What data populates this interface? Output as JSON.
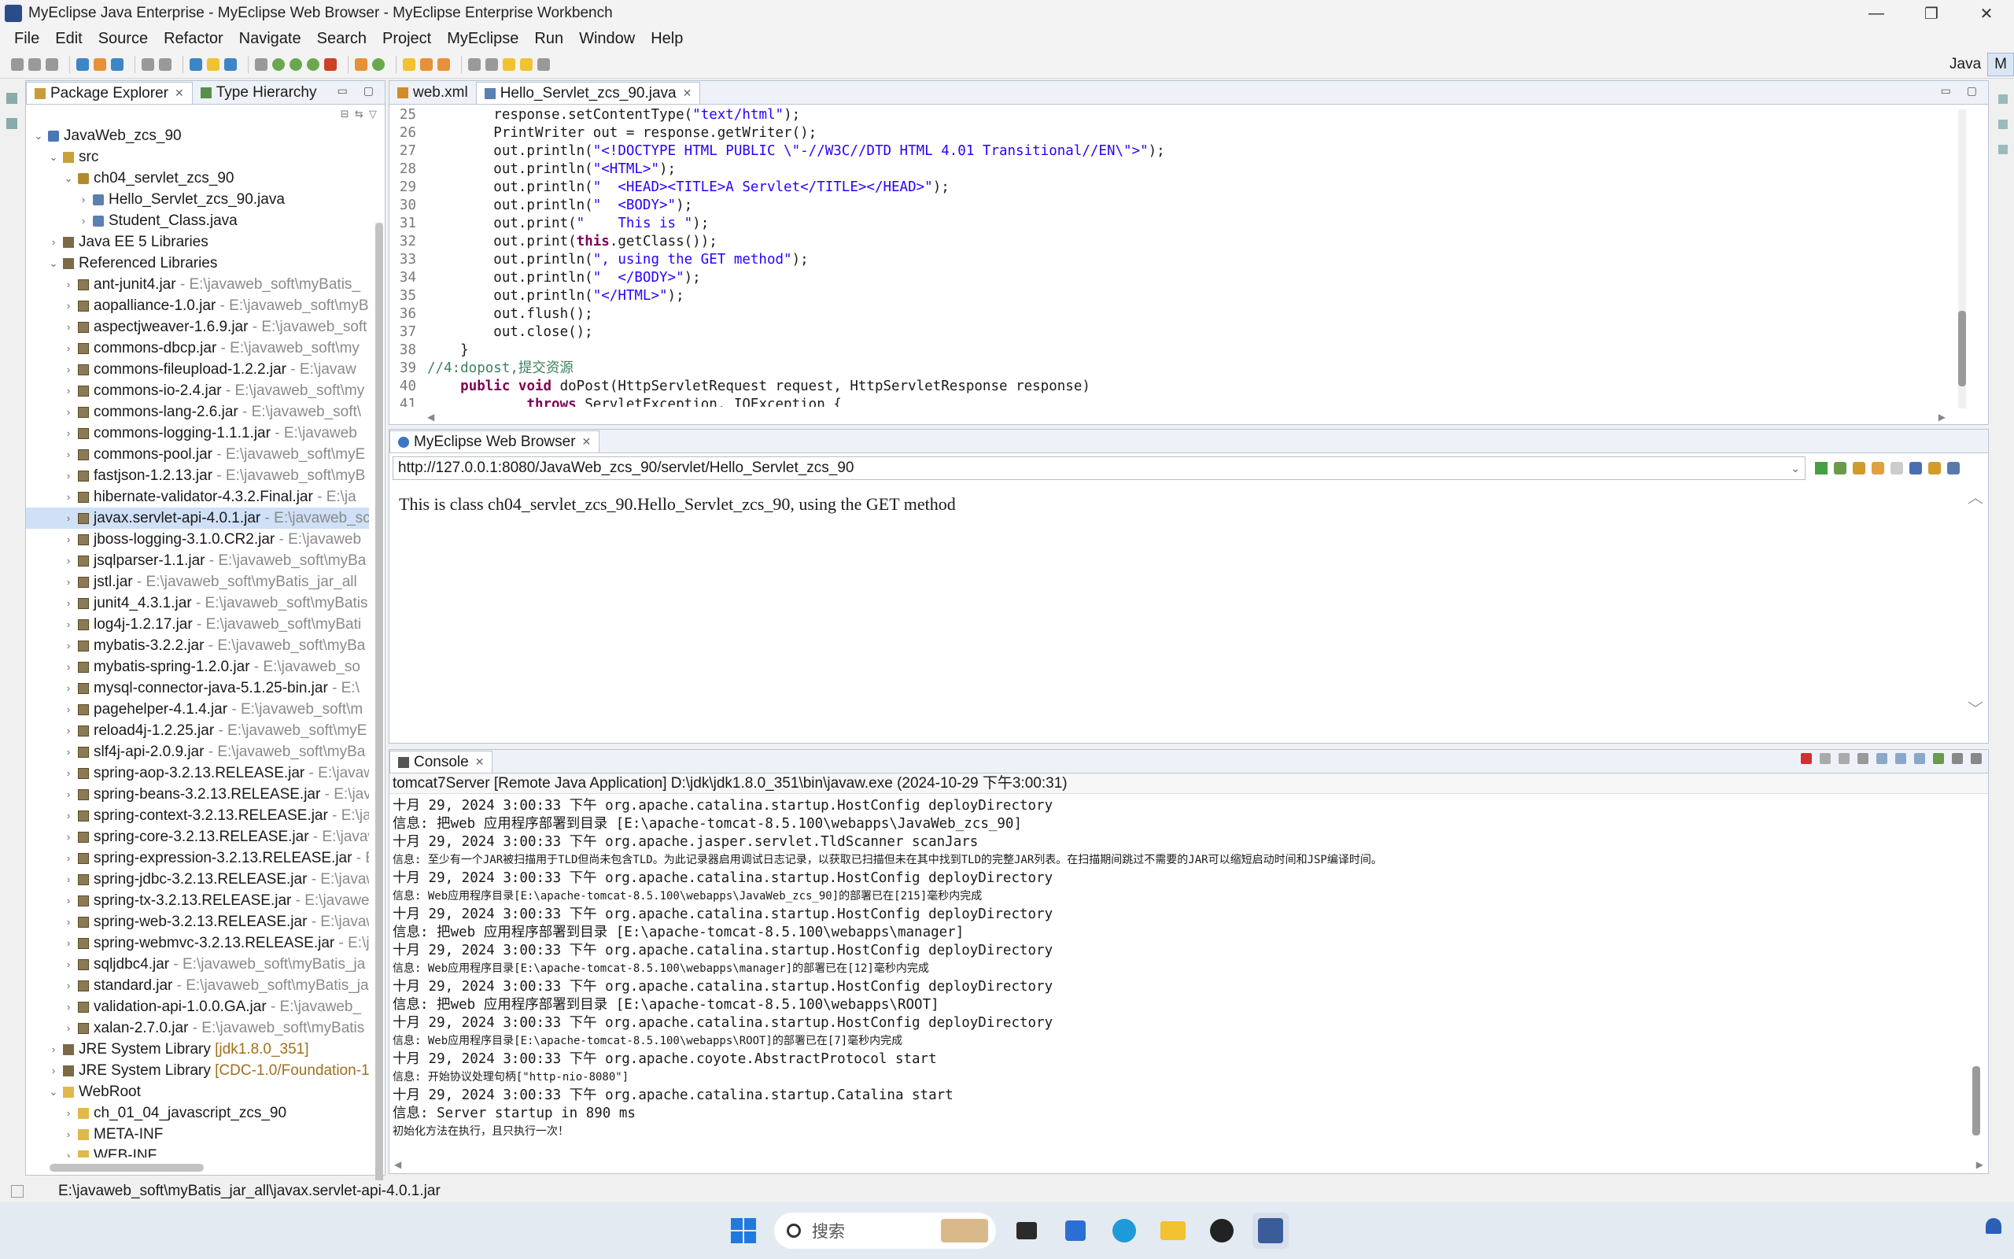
{
  "window": {
    "title": "MyEclipse Java Enterprise - MyEclipse Web Browser - MyEclipse Enterprise Workbench",
    "minimize": "—",
    "maximize": "❐",
    "close": "✕"
  },
  "menu": [
    "File",
    "Edit",
    "Source",
    "Refactor",
    "Navigate",
    "Search",
    "Project",
    "MyEclipse",
    "Run",
    "Window",
    "Help"
  ],
  "perspective": {
    "java": "Java",
    "myeclipse": "M"
  },
  "left_panel": {
    "tabs": [
      "Package Explorer",
      "Type Hierarchy"
    ],
    "tree": [
      {
        "label": "JavaWeb_zcs_90",
        "detail": "",
        "level": 0,
        "arrow": "v",
        "icon": "proj"
      },
      {
        "label": "src",
        "detail": "",
        "level": 1,
        "arrow": "v",
        "icon": "src"
      },
      {
        "label": "ch04_servlet_zcs_90",
        "detail": "",
        "level": 2,
        "arrow": "v",
        "icon": "pkgi"
      },
      {
        "label": "Hello_Servlet_zcs_90.java",
        "detail": "",
        "level": 3,
        "arrow": ">",
        "icon": "java"
      },
      {
        "label": "Student_Class.java",
        "detail": "",
        "level": 3,
        "arrow": ">",
        "icon": "java"
      },
      {
        "label": "Java EE 5 Libraries",
        "detail": "",
        "level": 1,
        "arrow": ">",
        "icon": "lib"
      },
      {
        "label": "Referenced Libraries",
        "detail": "",
        "level": 1,
        "arrow": "v",
        "icon": "lib"
      },
      {
        "label": "ant-junit4.jar",
        "detail": " - E:\\javaweb_soft\\myBatis_",
        "level": 2,
        "arrow": ">",
        "icon": "jar"
      },
      {
        "label": "aopalliance-1.0.jar",
        "detail": " - E:\\javaweb_soft\\myB",
        "level": 2,
        "arrow": ">",
        "icon": "jar"
      },
      {
        "label": "aspectjweaver-1.6.9.jar",
        "detail": " - E:\\javaweb_soft",
        "level": 2,
        "arrow": ">",
        "icon": "jar"
      },
      {
        "label": "commons-dbcp.jar",
        "detail": " - E:\\javaweb_soft\\my",
        "level": 2,
        "arrow": ">",
        "icon": "jar"
      },
      {
        "label": "commons-fileupload-1.2.2.jar",
        "detail": " - E:\\javaw",
        "level": 2,
        "arrow": ">",
        "icon": "jar"
      },
      {
        "label": "commons-io-2.4.jar",
        "detail": " - E:\\javaweb_soft\\my",
        "level": 2,
        "arrow": ">",
        "icon": "jar"
      },
      {
        "label": "commons-lang-2.6.jar",
        "detail": " - E:\\javaweb_soft\\",
        "level": 2,
        "arrow": ">",
        "icon": "jar"
      },
      {
        "label": "commons-logging-1.1.1.jar",
        "detail": " - E:\\javaweb",
        "level": 2,
        "arrow": ">",
        "icon": "jar"
      },
      {
        "label": "commons-pool.jar",
        "detail": " - E:\\javaweb_soft\\myE",
        "level": 2,
        "arrow": ">",
        "icon": "jar"
      },
      {
        "label": "fastjson-1.2.13.jar",
        "detail": " - E:\\javaweb_soft\\myB",
        "level": 2,
        "arrow": ">",
        "icon": "jar"
      },
      {
        "label": "hibernate-validator-4.3.2.Final.jar",
        "detail": " - E:\\ja",
        "level": 2,
        "arrow": ">",
        "icon": "jar"
      },
      {
        "label": "javax.servlet-api-4.0.1.jar",
        "detail": " - E:\\javaweb_sc",
        "level": 2,
        "arrow": ">",
        "icon": "jar",
        "selected": true
      },
      {
        "label": "jboss-logging-3.1.0.CR2.jar",
        "detail": " - E:\\javaweb",
        "level": 2,
        "arrow": ">",
        "icon": "jar"
      },
      {
        "label": "jsqlparser-1.1.jar",
        "detail": " - E:\\javaweb_soft\\myBa",
        "level": 2,
        "arrow": ">",
        "icon": "jar"
      },
      {
        "label": "jstl.jar",
        "detail": " - E:\\javaweb_soft\\myBatis_jar_all",
        "level": 2,
        "arrow": ">",
        "icon": "jar"
      },
      {
        "label": "junit4_4.3.1.jar",
        "detail": " - E:\\javaweb_soft\\myBatis",
        "level": 2,
        "arrow": ">",
        "icon": "jar"
      },
      {
        "label": "log4j-1.2.17.jar",
        "detail": " - E:\\javaweb_soft\\myBati",
        "level": 2,
        "arrow": ">",
        "icon": "jar"
      },
      {
        "label": "mybatis-3.2.2.jar",
        "detail": " - E:\\javaweb_soft\\myBa",
        "level": 2,
        "arrow": ">",
        "icon": "jar"
      },
      {
        "label": "mybatis-spring-1.2.0.jar",
        "detail": " - E:\\javaweb_so",
        "level": 2,
        "arrow": ">",
        "icon": "jar"
      },
      {
        "label": "mysql-connector-java-5.1.25-bin.jar",
        "detail": " - E:\\",
        "level": 2,
        "arrow": ">",
        "icon": "jar"
      },
      {
        "label": "pagehelper-4.1.4.jar",
        "detail": " - E:\\javaweb_soft\\m",
        "level": 2,
        "arrow": ">",
        "icon": "jar"
      },
      {
        "label": "reload4j-1.2.25.jar",
        "detail": " - E:\\javaweb_soft\\myE",
        "level": 2,
        "arrow": ">",
        "icon": "jar"
      },
      {
        "label": "slf4j-api-2.0.9.jar",
        "detail": " - E:\\javaweb_soft\\myBa",
        "level": 2,
        "arrow": ">",
        "icon": "jar"
      },
      {
        "label": "spring-aop-3.2.13.RELEASE.jar",
        "detail": " - E:\\javaw",
        "level": 2,
        "arrow": ">",
        "icon": "jar"
      },
      {
        "label": "spring-beans-3.2.13.RELEASE.jar",
        "detail": " - E:\\javc",
        "level": 2,
        "arrow": ">",
        "icon": "jar"
      },
      {
        "label": "spring-context-3.2.13.RELEASE.jar",
        "detail": " - E:\\ja",
        "level": 2,
        "arrow": ">",
        "icon": "jar"
      },
      {
        "label": "spring-core-3.2.13.RELEASE.jar",
        "detail": " - E:\\javaw",
        "level": 2,
        "arrow": ">",
        "icon": "jar"
      },
      {
        "label": "spring-expression-3.2.13.RELEASE.jar",
        "detail": " - E",
        "level": 2,
        "arrow": ">",
        "icon": "jar"
      },
      {
        "label": "spring-jdbc-3.2.13.RELEASE.jar",
        "detail": " - E:\\javaw",
        "level": 2,
        "arrow": ">",
        "icon": "jar"
      },
      {
        "label": "spring-tx-3.2.13.RELEASE.jar",
        "detail": " - E:\\javawel",
        "level": 2,
        "arrow": ">",
        "icon": "jar"
      },
      {
        "label": "spring-web-3.2.13.RELEASE.jar",
        "detail": " - E:\\javaw",
        "level": 2,
        "arrow": ">",
        "icon": "jar"
      },
      {
        "label": "spring-webmvc-3.2.13.RELEASE.jar",
        "detail": " - E:\\ja",
        "level": 2,
        "arrow": ">",
        "icon": "jar"
      },
      {
        "label": "sqljdbc4.jar",
        "detail": " - E:\\javaweb_soft\\myBatis_ja",
        "level": 2,
        "arrow": ">",
        "icon": "jar"
      },
      {
        "label": "standard.jar",
        "detail": " - E:\\javaweb_soft\\myBatis_ja",
        "level": 2,
        "arrow": ">",
        "icon": "jar"
      },
      {
        "label": "validation-api-1.0.0.GA.jar",
        "detail": " - E:\\javaweb_",
        "level": 2,
        "arrow": ">",
        "icon": "jar"
      },
      {
        "label": "xalan-2.7.0.jar",
        "detail": " - E:\\javaweb_soft\\myBatis",
        "level": 2,
        "arrow": ">",
        "icon": "jar"
      },
      {
        "label": "JRE System Library",
        "detail": " [jdk1.8.0_351]",
        "level": 1,
        "arrow": ">",
        "icon": "lib",
        "amber": true
      },
      {
        "label": "JRE System Library",
        "detail": " [CDC-1.0/Foundation-1",
        "level": 1,
        "arrow": ">",
        "icon": "lib",
        "amber": true
      },
      {
        "label": "WebRoot",
        "detail": "",
        "level": 1,
        "arrow": "v",
        "icon": "folder"
      },
      {
        "label": "ch_01_04_javascript_zcs_90",
        "detail": "",
        "level": 2,
        "arrow": ">",
        "icon": "folder"
      },
      {
        "label": "META-INF",
        "detail": "",
        "level": 2,
        "arrow": ">",
        "icon": "folder"
      },
      {
        "label": "WEB-INF",
        "detail": "",
        "level": 2,
        "arrow": ">",
        "icon": "folder"
      }
    ]
  },
  "editor": {
    "tabs": [
      "web.xml",
      "Hello_Servlet_zcs_90.java"
    ],
    "lines": [
      {
        "n": "25",
        "html": "        response.setContentType(<span class=\"str\">\"text/html\"</span>);"
      },
      {
        "n": "26",
        "html": "        PrintWriter out = response.getWriter();"
      },
      {
        "n": "27",
        "html": "        out.println(<span class=\"str\">\"&lt;!DOCTYPE HTML PUBLIC \\\"-//W3C//DTD HTML 4.01 Transitional//EN\\\"&gt;\"</span>);"
      },
      {
        "n": "28",
        "html": "        out.println(<span class=\"str\">\"&lt;HTML&gt;\"</span>);"
      },
      {
        "n": "29",
        "html": "        out.println(<span class=\"str\">\"  &lt;HEAD&gt;&lt;TITLE&gt;A Servlet&lt;/TITLE&gt;&lt;/HEAD&gt;\"</span>);"
      },
      {
        "n": "30",
        "html": "        out.println(<span class=\"str\">\"  &lt;BODY&gt;\"</span>);"
      },
      {
        "n": "31",
        "html": "        out.print(<span class=\"str\">\"    This is \"</span>);"
      },
      {
        "n": "32",
        "html": "        out.print(<span class=\"kw\">this</span>.getClass());"
      },
      {
        "n": "33",
        "html": "        out.println(<span class=\"str\">\", using the GET method\"</span>);"
      },
      {
        "n": "34",
        "html": "        out.println(<span class=\"str\">\"  &lt;/BODY&gt;\"</span>);"
      },
      {
        "n": "35",
        "html": "        out.println(<span class=\"str\">\"&lt;/HTML&gt;\"</span>);"
      },
      {
        "n": "36",
        "html": "        out.flush();"
      },
      {
        "n": "37",
        "html": "        out.close();"
      },
      {
        "n": "38",
        "html": "    }"
      },
      {
        "n": "39",
        "html": "<span class=\"cmt\">//4:dopost,提交资源</span>"
      },
      {
        "n": "40",
        "html": "    <span class=\"kw\">public void</span> doPost(HttpServletRequest request, HttpServletResponse response)"
      },
      {
        "n": "41",
        "html": "            <span class=\"kw\">throws</span> ServletException, IOException {"
      }
    ]
  },
  "browser": {
    "tab": "MyEclipse Web Browser",
    "url": "http://127.0.0.1:8080/JavaWeb_zcs_90/servlet/Hello_Servlet_zcs_90",
    "content": "This is class ch04_servlet_zcs_90.Hello_Servlet_zcs_90, using the GET method"
  },
  "console": {
    "tab": "Console",
    "title": "tomcat7Server [Remote Java Application] D:\\jdk\\jdk1.8.0_351\\bin\\javaw.exe (2024-10-29 下午3:00:31)",
    "lines": [
      {
        "t": "十月 29, 2024 3:00:33 下午 org.apache.catalina.startup.HostConfig deployDirectory",
        "small": false
      },
      {
        "t": "信息: 把web 应用程序部署到目录 [E:\\apache-tomcat-8.5.100\\webapps\\JavaWeb_zcs_90]",
        "small": false
      },
      {
        "t": "十月 29, 2024 3:00:33 下午 org.apache.jasper.servlet.TldScanner scanJars",
        "small": false
      },
      {
        "t": "信息: 至少有一个JAR被扫描用于TLD但尚未包含TLD。为此记录器启用调试日志记录，以获取已扫描但未在其中找到TLD的完整JAR列表。在扫描期间跳过不需要的JAR可以缩短启动时间和JSP编译时间。",
        "small": true
      },
      {
        "t": "十月 29, 2024 3:00:33 下午 org.apache.catalina.startup.HostConfig deployDirectory",
        "small": false
      },
      {
        "t": "信息: Web应用程序目录[E:\\apache-tomcat-8.5.100\\webapps\\JavaWeb_zcs_90]的部署已在[215]毫秒内完成",
        "small": true
      },
      {
        "t": "十月 29, 2024 3:00:33 下午 org.apache.catalina.startup.HostConfig deployDirectory",
        "small": false
      },
      {
        "t": "信息: 把web 应用程序部署到目录 [E:\\apache-tomcat-8.5.100\\webapps\\manager]",
        "small": false
      },
      {
        "t": "十月 29, 2024 3:00:33 下午 org.apache.catalina.startup.HostConfig deployDirectory",
        "small": false
      },
      {
        "t": "信息: Web应用程序目录[E:\\apache-tomcat-8.5.100\\webapps\\manager]的部署已在[12]毫秒内完成",
        "small": true
      },
      {
        "t": "十月 29, 2024 3:00:33 下午 org.apache.catalina.startup.HostConfig deployDirectory",
        "small": false
      },
      {
        "t": "信息: 把web 应用程序部署到目录 [E:\\apache-tomcat-8.5.100\\webapps\\ROOT]",
        "small": false
      },
      {
        "t": "十月 29, 2024 3:00:33 下午 org.apache.catalina.startup.HostConfig deployDirectory",
        "small": false
      },
      {
        "t": "信息: Web应用程序目录[E:\\apache-tomcat-8.5.100\\webapps\\ROOT]的部署已在[7]毫秒内完成",
        "small": true
      },
      {
        "t": "十月 29, 2024 3:00:33 下午 org.apache.coyote.AbstractProtocol start",
        "small": false
      },
      {
        "t": "信息: 开始协议处理句柄[\"http-nio-8080\"]",
        "small": true
      },
      {
        "t": "十月 29, 2024 3:00:33 下午 org.apache.catalina.startup.Catalina start",
        "small": false
      },
      {
        "t": "信息: Server startup in 890 ms",
        "small": false
      },
      {
        "t": "初始化方法在执行，且只执行一次！",
        "small": true
      }
    ]
  },
  "status": {
    "text": "E:\\javaweb_soft\\myBatis_jar_all\\javax.servlet-api-4.0.1.jar"
  },
  "taskbar": {
    "search_placeholder": "搜索"
  },
  "colors": {
    "selection": "#cfe0f7",
    "keyword": "#7f0055",
    "string": "#2a00ff",
    "comment": "#3f7f5f"
  }
}
